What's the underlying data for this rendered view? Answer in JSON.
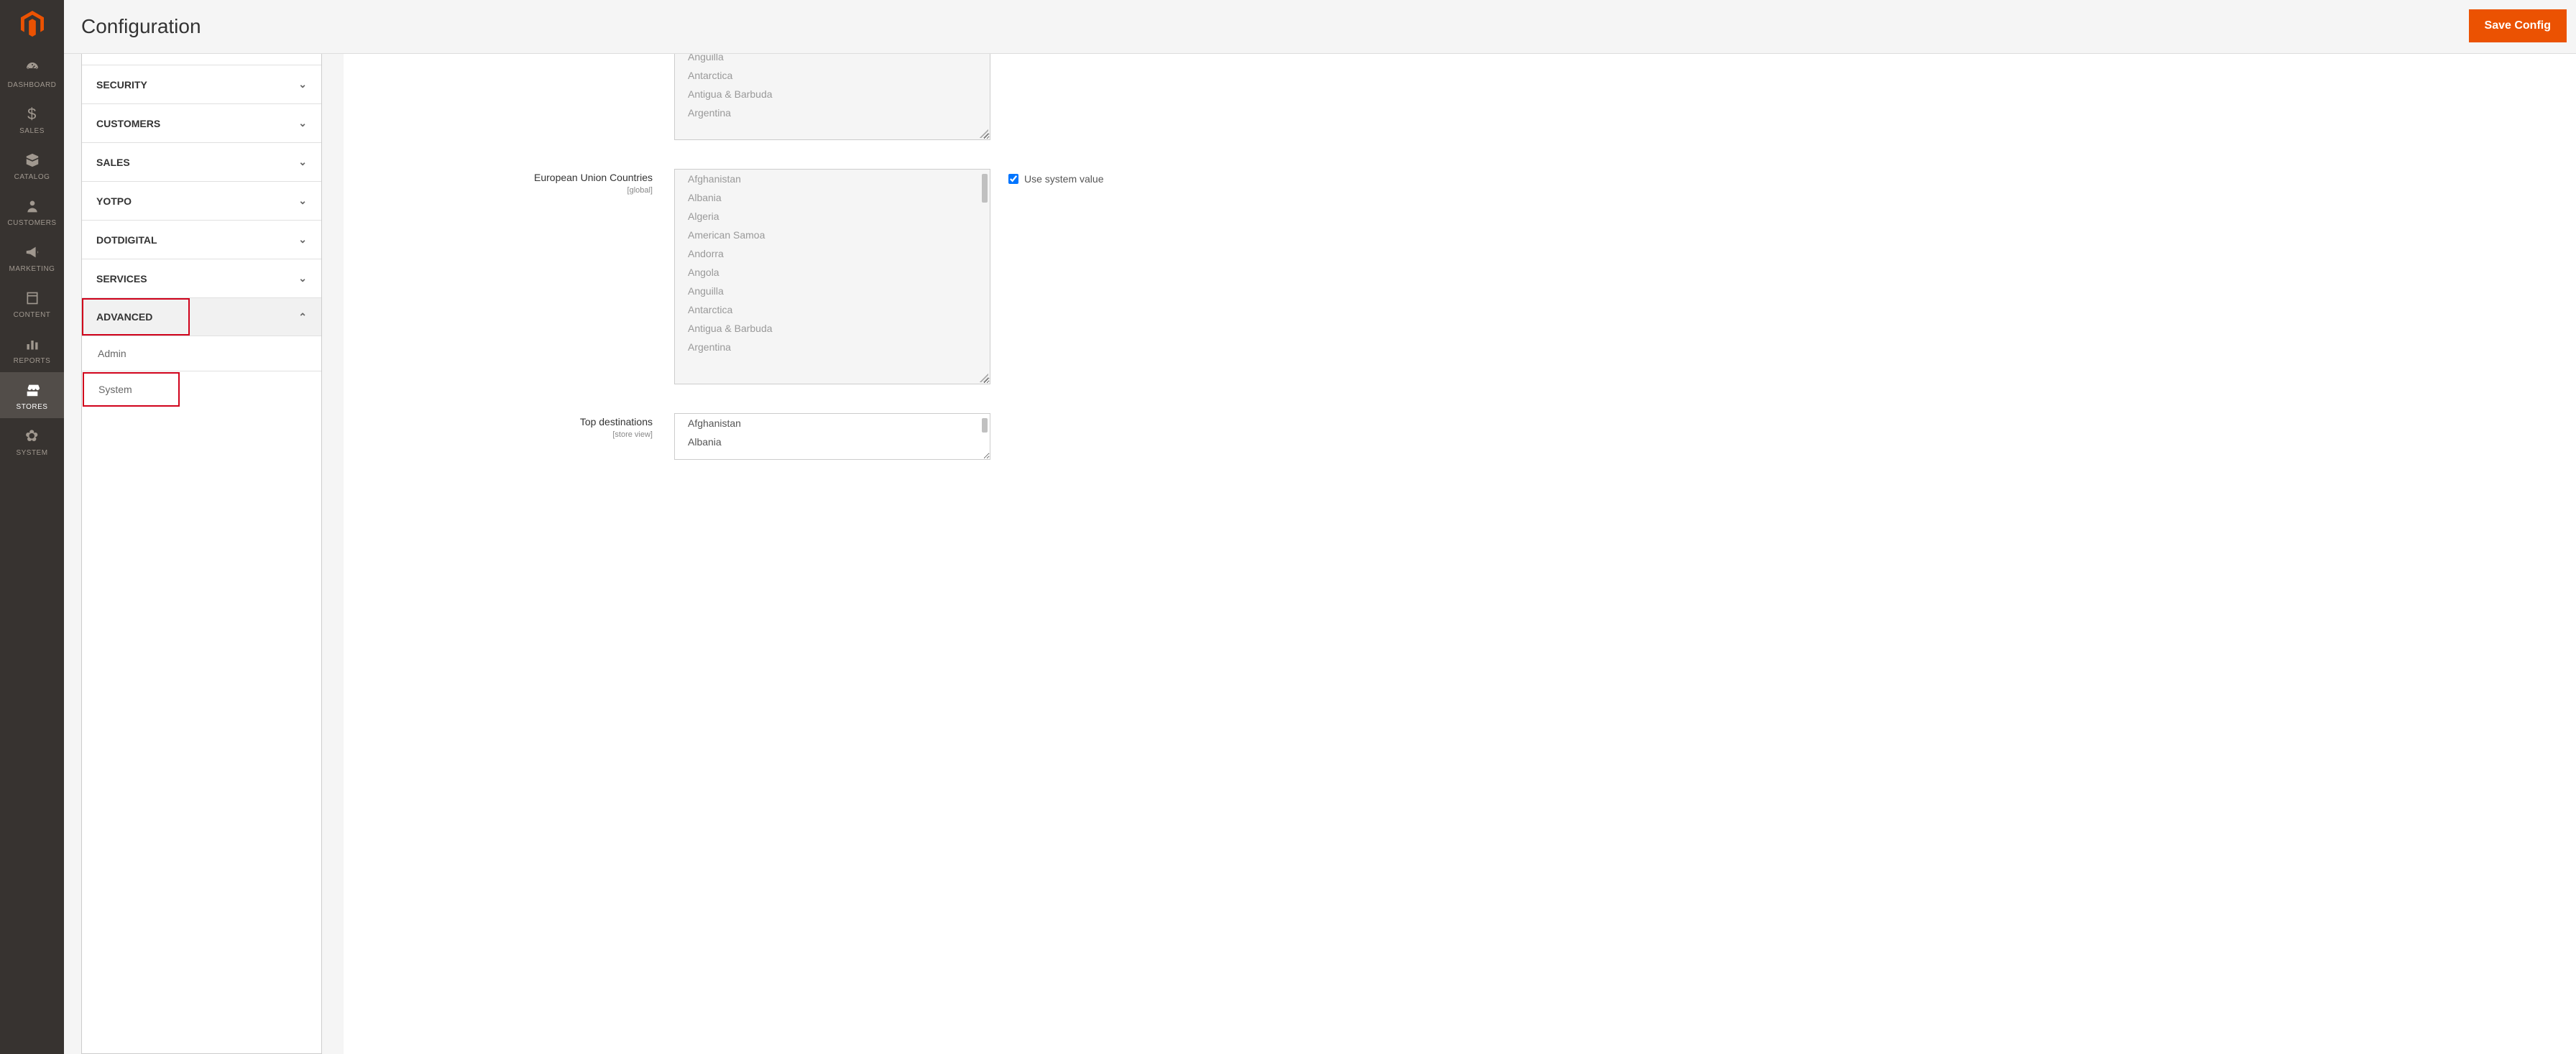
{
  "header": {
    "title": "Configuration",
    "save_label": "Save Config"
  },
  "sidebar": {
    "items": [
      {
        "label": "DASHBOARD",
        "icon": "dashboard"
      },
      {
        "label": "SALES",
        "icon": "dollar"
      },
      {
        "label": "CATALOG",
        "icon": "box"
      },
      {
        "label": "CUSTOMERS",
        "icon": "person"
      },
      {
        "label": "MARKETING",
        "icon": "megaphone"
      },
      {
        "label": "CONTENT",
        "icon": "page"
      },
      {
        "label": "REPORTS",
        "icon": "bars"
      },
      {
        "label": "STORES",
        "icon": "storefront"
      },
      {
        "label": "SYSTEM",
        "icon": "gear"
      }
    ]
  },
  "config_panel": {
    "sections": [
      {
        "label": "SECURITY"
      },
      {
        "label": "CUSTOMERS"
      },
      {
        "label": "SALES"
      },
      {
        "label": "YOTPO"
      },
      {
        "label": "DOTDIGITAL"
      },
      {
        "label": "SERVICES"
      },
      {
        "label": "ADVANCED",
        "expanded": true,
        "highlight": true
      }
    ],
    "advanced_children": [
      {
        "label": "Admin"
      },
      {
        "label": "System",
        "highlight": true
      }
    ]
  },
  "form": {
    "first_box": {
      "options": [
        "Anguilla",
        "Antarctica",
        "Antigua & Barbuda",
        "Argentina"
      ]
    },
    "eu_countries": {
      "label": "European Union Countries",
      "scope": "[global]",
      "use_system": "Use system value",
      "options": [
        "Afghanistan",
        "Albania",
        "Algeria",
        "American Samoa",
        "Andorra",
        "Angola",
        "Anguilla",
        "Antarctica",
        "Antigua & Barbuda",
        "Argentina"
      ]
    },
    "top_dest": {
      "label": "Top destinations",
      "scope": "[store view]",
      "options": [
        "Afghanistan",
        "Albania"
      ]
    }
  }
}
